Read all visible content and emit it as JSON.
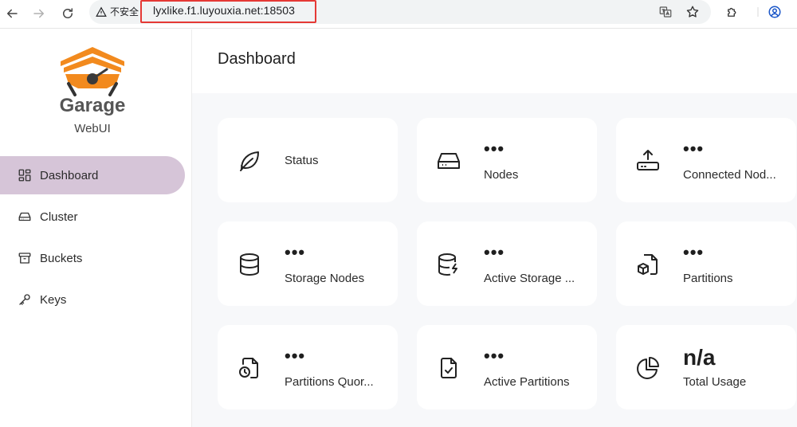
{
  "browser": {
    "security_label": "不安全",
    "url": "lyxlike.f1.luyouxia.net:18503"
  },
  "sidebar": {
    "brand": "Garage",
    "subtitle": "WebUI",
    "items": [
      {
        "label": "Dashboard",
        "icon": "dashboard-icon",
        "active": true
      },
      {
        "label": "Cluster",
        "icon": "drive-icon",
        "active": false
      },
      {
        "label": "Buckets",
        "icon": "archive-icon",
        "active": false
      },
      {
        "label": "Keys",
        "icon": "key-icon",
        "active": false
      }
    ]
  },
  "page": {
    "title": "Dashboard"
  },
  "cards": [
    {
      "value": "",
      "label": "Status",
      "icon": "leaf-icon"
    },
    {
      "value": "•••",
      "label": "Nodes",
      "icon": "hard-drive-icon"
    },
    {
      "value": "•••",
      "label": "Connected Nod...",
      "icon": "upload-drive-icon"
    },
    {
      "value": "•••",
      "label": "Storage Nodes",
      "icon": "database-icon"
    },
    {
      "value": "•••",
      "label": "Active Storage ...",
      "icon": "database-zap-icon"
    },
    {
      "value": "•••",
      "label": "Partitions",
      "icon": "file-box-icon"
    },
    {
      "value": "•••",
      "label": "Partitions Quor...",
      "icon": "file-clock-icon"
    },
    {
      "value": "•••",
      "label": "Active Partitions",
      "icon": "file-check-icon"
    },
    {
      "value": "n/a",
      "label": "Total Usage",
      "icon": "pie-chart-icon"
    }
  ],
  "colors": {
    "accent_active": "#d6c5d8",
    "logo_orange": "#f28a1e",
    "annotation_red": "#e53935"
  }
}
